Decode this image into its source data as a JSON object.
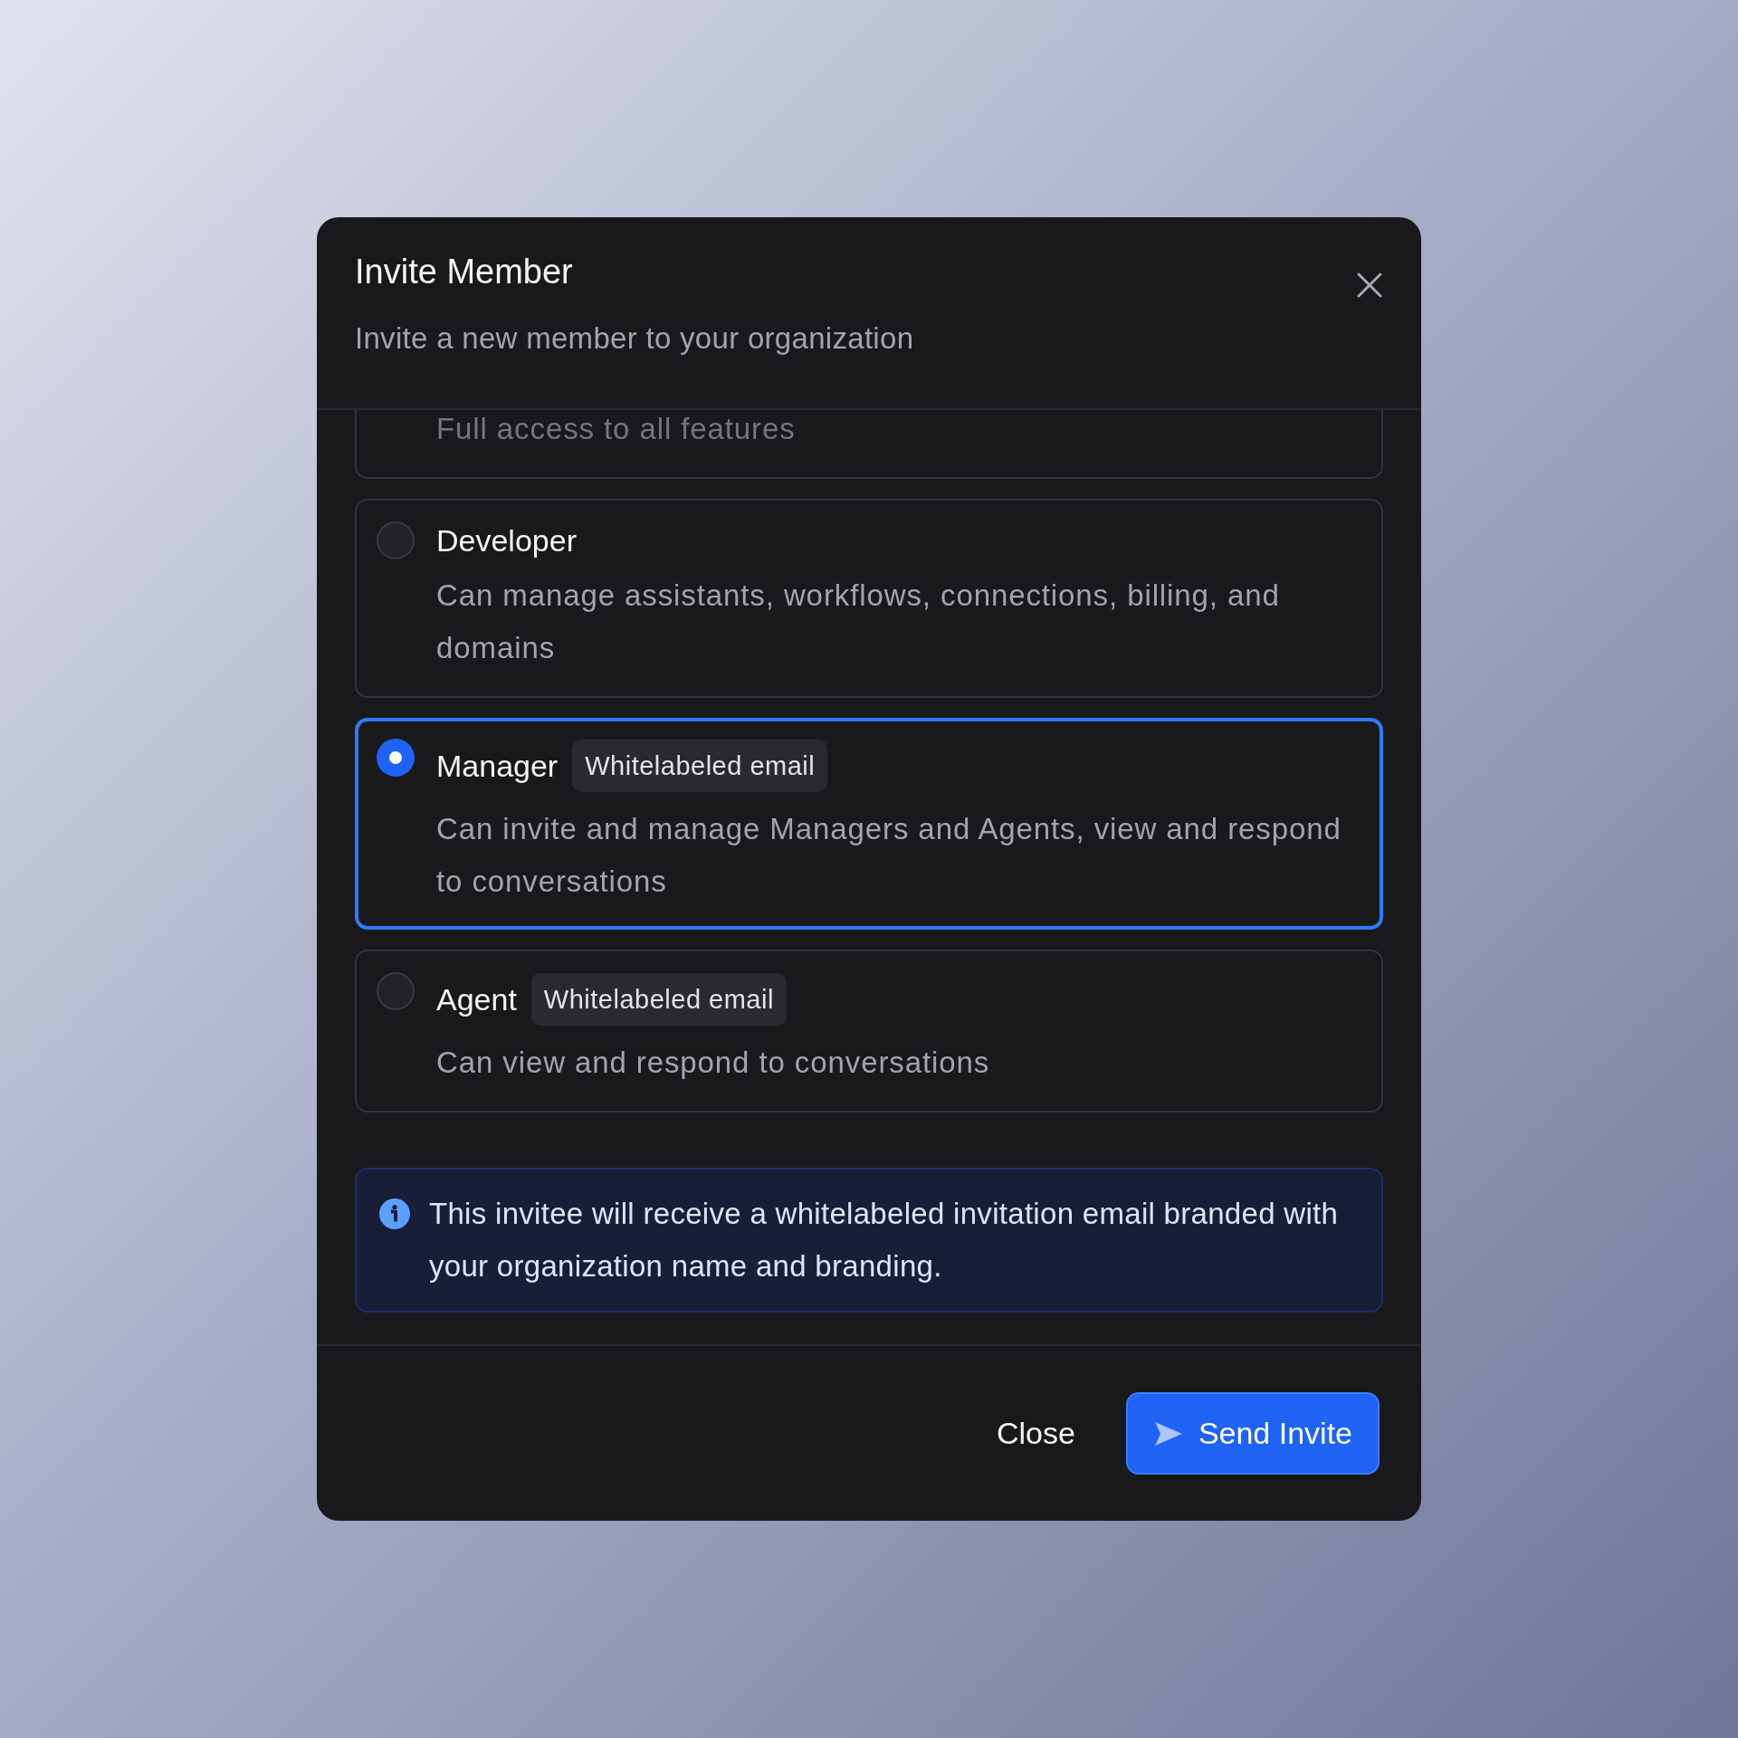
{
  "dialog": {
    "title": "Invite Member",
    "subtitle": "Invite a new member to your organization"
  },
  "roles": [
    {
      "description": "Full access to all features"
    },
    {
      "name": "Developer",
      "description": "Can manage assistants, workflows, connections, billing, and domains",
      "selected": false
    },
    {
      "name": "Manager",
      "badge": "Whitelabeled email",
      "description": "Can invite and manage Managers and Agents, view and respond to conversations",
      "selected": true
    },
    {
      "name": "Agent",
      "badge": "Whitelabeled email",
      "description": "Can view and respond to conversations",
      "selected": false
    }
  ],
  "notice": {
    "text": "This invitee will receive a whitelabeled invitation email branded with your organization name and branding."
  },
  "buttons": [
    {
      "kind": "secondary",
      "label": "Close"
    },
    {
      "kind": "primary",
      "label": "Send Invite"
    }
  ]
}
